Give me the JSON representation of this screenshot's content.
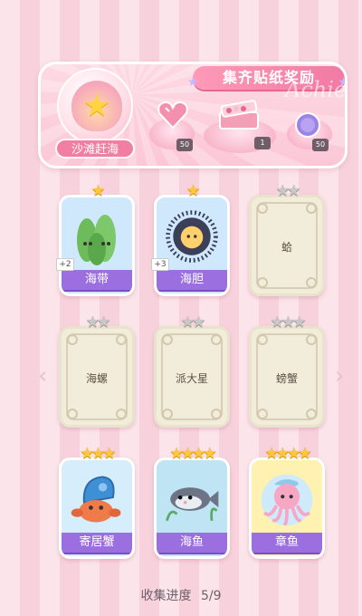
{
  "banner": {
    "title": "集齐贴纸奖励",
    "script_text": "Achieem",
    "shell_label": "沙滩赶海",
    "rewards": [
      {
        "icon": "pink-heart-gem-icon",
        "count": "50"
      },
      {
        "icon": "treasure-box-icon",
        "count": "1"
      },
      {
        "icon": "purple-coin-icon",
        "count": "50"
      }
    ]
  },
  "nav": {
    "left": "‹",
    "right": "›"
  },
  "cards": [
    {
      "name": "海带",
      "stars": 1,
      "max_stars": 1,
      "unlocked": true,
      "extra": "+2",
      "art": "seaweed-icon",
      "bg": "#cfe8fb"
    },
    {
      "name": "海胆",
      "stars": 1,
      "max_stars": 1,
      "unlocked": true,
      "extra": "+3",
      "art": "sea-urchin-icon",
      "bg": "#cfe8fb"
    },
    {
      "name": "蛤",
      "stars": 0,
      "max_stars": 2,
      "unlocked": false
    },
    {
      "name": "海螺",
      "stars": 0,
      "max_stars": 2,
      "unlocked": false
    },
    {
      "name": "派大星",
      "stars": 0,
      "max_stars": 2,
      "unlocked": false
    },
    {
      "name": "螃蟹",
      "stars": 0,
      "max_stars": 3,
      "unlocked": false
    },
    {
      "name": "寄居蟹",
      "stars": 3,
      "max_stars": 3,
      "unlocked": true,
      "art": "hermit-crab-icon",
      "bg": "#d6edfb"
    },
    {
      "name": "海鱼",
      "stars": 4,
      "max_stars": 4,
      "unlocked": true,
      "art": "sea-fish-icon",
      "bg": "#bfe4f4"
    },
    {
      "name": "章鱼",
      "stars": 4,
      "max_stars": 4,
      "unlocked": true,
      "art": "octopus-icon",
      "bg": "#fff2b0"
    }
  ],
  "progress": {
    "label": "收集进度",
    "value": "5/9"
  },
  "colors": {
    "ribbon": "#9b6fe0",
    "banner_title": "#f07aa3",
    "star_gold": "#ffc83a",
    "star_gray": "#c8c8c8"
  }
}
